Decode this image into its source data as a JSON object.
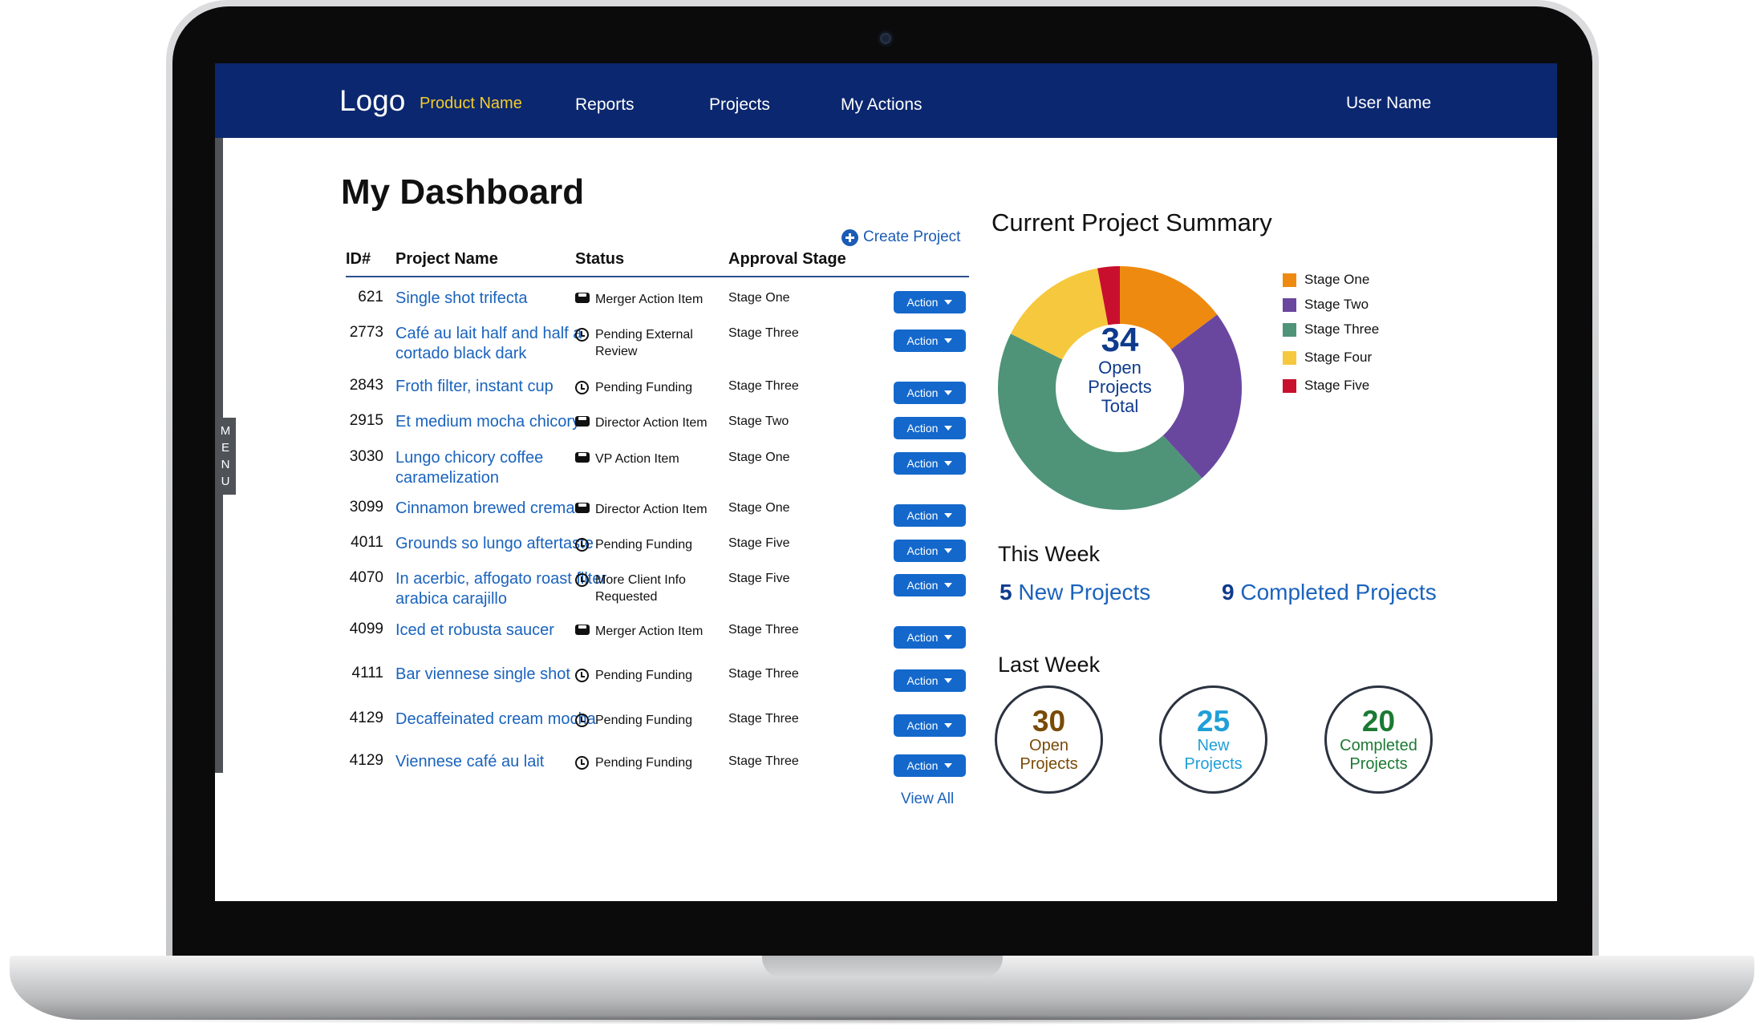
{
  "header": {
    "logo": "Logo",
    "product_name": "Product Name",
    "nav": [
      "Reports",
      "Projects",
      "My Actions"
    ],
    "user_name": "User Name"
  },
  "side_menu": {
    "letters": [
      "M",
      "E",
      "N",
      "U"
    ]
  },
  "dashboard": {
    "title": "My Dashboard",
    "create_project": "Create Project",
    "view_all": "View All",
    "columns": {
      "id": "ID#",
      "name": "Project Name",
      "status": "Status",
      "stage": "Approval Stage"
    },
    "action_label": "Action",
    "rows": [
      {
        "id": "621",
        "name": "Single shot trifecta",
        "status": "Merger Action Item",
        "status_icon": "inbox-icon",
        "stage": "Stage One"
      },
      {
        "id": "2773",
        "name": "Café au lait half and half a cortado black dark",
        "status": "Pending External Review",
        "status_icon": "clock-icon",
        "stage": "Stage Three"
      },
      {
        "id": "2843",
        "name": "Froth filter, instant cup",
        "status": "Pending Funding",
        "status_icon": "clock-icon",
        "stage": "Stage Three"
      },
      {
        "id": "2915",
        "name": "Et medium mocha chicory",
        "status": "Director Action Item",
        "status_icon": "inbox-icon",
        "stage": "Stage Two"
      },
      {
        "id": "3030",
        "name": "Lungo chicory coffee caramelization",
        "status": "VP Action Item",
        "status_icon": "inbox-icon",
        "stage": "Stage One"
      },
      {
        "id": "3099",
        "name": "Cinnamon brewed crema",
        "status": "Director Action Item",
        "status_icon": "inbox-icon",
        "stage": "Stage One"
      },
      {
        "id": "4011",
        "name": "Grounds so lungo aftertaste",
        "status": "Pending Funding",
        "status_icon": "clock-icon",
        "stage": "Stage Five"
      },
      {
        "id": "4070",
        "name": "In acerbic, affogato roast filter arabica carajillo",
        "status": "More Client Info Requested",
        "status_icon": "clock-icon",
        "stage": "Stage Five"
      },
      {
        "id": "4099",
        "name": "Iced et robusta saucer",
        "status": "Merger Action Item",
        "status_icon": "inbox-icon",
        "stage": "Stage Three"
      },
      {
        "id": "4111",
        "name": "Bar viennese single shot",
        "status": "Pending Funding",
        "status_icon": "clock-icon",
        "stage": "Stage Three"
      },
      {
        "id": "4129",
        "name": "Decaffeinated cream mocha",
        "status": "Pending Funding",
        "status_icon": "clock-icon",
        "stage": "Stage Three"
      },
      {
        "id": "4129",
        "name": "Viennese café au lait",
        "status": "Pending Funding",
        "status_icon": "clock-icon",
        "stage": "Stage Three"
      }
    ]
  },
  "summary": {
    "title": "Current Project Summary",
    "total": "34",
    "total_label": [
      "Open",
      "Projects",
      "Total"
    ],
    "chart_data": {
      "type": "pie",
      "categories": [
        "Stage One",
        "Stage Two",
        "Stage Three",
        "Stage Four",
        "Stage Five"
      ],
      "values": [
        5,
        8,
        15,
        5,
        1
      ],
      "colors": [
        "#ef8a10",
        "#6a479f",
        "#4f9478",
        "#f6c83d",
        "#c8102e"
      ],
      "legend": "right"
    },
    "this_week": {
      "title": "This Week",
      "new_count": "5",
      "new_label": "New Projects",
      "completed_count": "9",
      "completed_label": "Completed Projects"
    },
    "last_week": {
      "title": "Last Week",
      "circles": [
        {
          "value": "30",
          "label": [
            "Open",
            "Projects"
          ],
          "color": "#7a4a07"
        },
        {
          "value": "25",
          "label": [
            "New",
            "Projects"
          ],
          "color": "#1f9fd8"
        },
        {
          "value": "20",
          "label": [
            "Completed",
            "Projects"
          ],
          "color": "#1c7a33"
        }
      ]
    }
  }
}
